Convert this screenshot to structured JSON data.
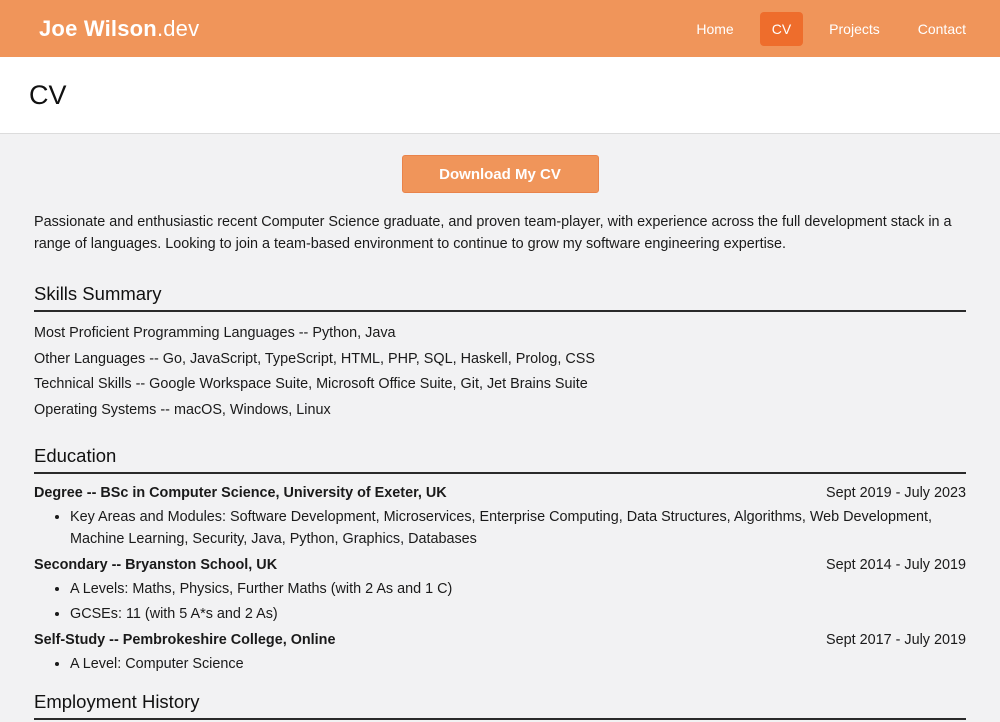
{
  "navbar": {
    "brand_name": "Joe Wilson",
    "brand_tld": ".dev",
    "links": [
      {
        "label": "Home",
        "active": false
      },
      {
        "label": "CV",
        "active": true
      },
      {
        "label": "Projects",
        "active": false
      },
      {
        "label": "Contact",
        "active": false
      }
    ],
    "accent_color": "#f0955a",
    "active_color": "#ee6d2c"
  },
  "page": {
    "title": "CV"
  },
  "main": {
    "download_label": "Download My CV",
    "intro": "Passionate and enthusiastic recent Computer Science graduate, and proven team-player, with experience across the full development stack in a range of languages. Looking to join a team-based environment to continue to grow my software engineering expertise.",
    "skills": {
      "heading": "Skills Summary",
      "items": [
        "Most Proficient Programming Languages -- Python, Java",
        "Other Languages -- Go, JavaScript, TypeScript, HTML, PHP, SQL, Haskell, Prolog, CSS",
        "Technical Skills -- Google Workspace Suite, Microsoft Office Suite, Git, Jet Brains Suite",
        "Operating Systems -- macOS, Windows, Linux"
      ]
    },
    "education": {
      "heading": "Education",
      "entries": [
        {
          "title": "Degree -- BSc in Computer Science, University of Exeter, UK",
          "dates": "Sept 2019 - July 2023",
          "points": [
            "Key Areas and Modules: Software Development, Microservices, Enterprise Computing, Data Structures, Algorithms, Web Development, Machine Learning, Security, Java, Python, Graphics, Databases"
          ]
        },
        {
          "title": "Secondary -- Bryanston School, UK",
          "dates": "Sept 2014 - July 2019",
          "points": [
            "A Levels: Maths, Physics, Further Maths (with 2 As and 1 C)",
            "GCSEs: 11 (with 5 A*s and 2 As)"
          ]
        },
        {
          "title": "Self-Study -- Pembrokeshire College, Online",
          "dates": "Sept 2017 - July 2019",
          "points": [
            "A Level: Computer Science"
          ]
        }
      ]
    },
    "employment": {
      "heading": "Employment History"
    }
  }
}
